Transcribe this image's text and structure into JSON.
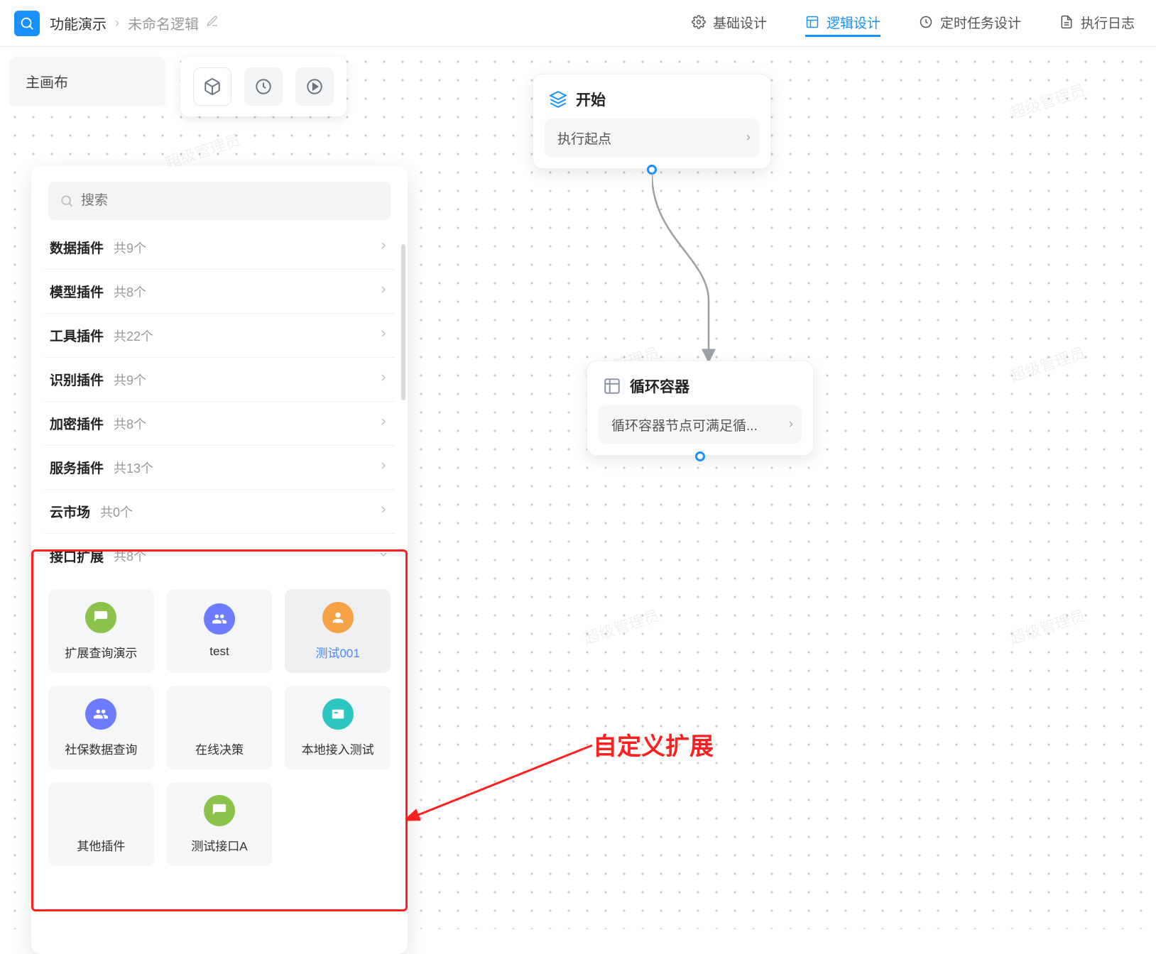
{
  "topbar": {
    "breadcrumb_main": "功能演示",
    "breadcrumb_sub": "未命名逻辑"
  },
  "topnav": {
    "basic": "基础设计",
    "logic": "逻辑设计",
    "schedule": "定时任务设计",
    "log": "执行日志"
  },
  "left_tab": {
    "label": "主画布"
  },
  "search": {
    "placeholder": "搜索"
  },
  "categories": [
    {
      "label": "数据插件",
      "count": "共9个"
    },
    {
      "label": "模型插件",
      "count": "共8个"
    },
    {
      "label": "工具插件",
      "count": "共22个"
    },
    {
      "label": "识别插件",
      "count": "共9个"
    },
    {
      "label": "加密插件",
      "count": "共8个"
    },
    {
      "label": "服务插件",
      "count": "共13个"
    },
    {
      "label": "云市场",
      "count": "共0个"
    },
    {
      "label": "接口扩展",
      "count": "共8个",
      "open": true
    }
  ],
  "plugins": [
    {
      "name": "扩展查询演示",
      "icon": "chat",
      "color": "green"
    },
    {
      "name": "test",
      "icon": "people",
      "color": "blue"
    },
    {
      "name": "测试001",
      "icon": "person",
      "color": "orange",
      "selected": true
    },
    {
      "name": "社保数据查询",
      "icon": "people",
      "color": "blue"
    },
    {
      "name": "在线决策",
      "icon": "",
      "color": ""
    },
    {
      "name": "本地接入测试",
      "icon": "card",
      "color": "teal"
    },
    {
      "name": "其他插件",
      "icon": "",
      "color": ""
    },
    {
      "name": "测试接口A",
      "icon": "chat",
      "color": "green"
    }
  ],
  "annotation": {
    "label": "自定义扩展"
  },
  "nodes": {
    "start": {
      "title": "开始",
      "body": "执行起点"
    },
    "loop": {
      "title": "循环容器",
      "body": "循环容器节点可满足循..."
    }
  },
  "watermark": "超级管理员"
}
